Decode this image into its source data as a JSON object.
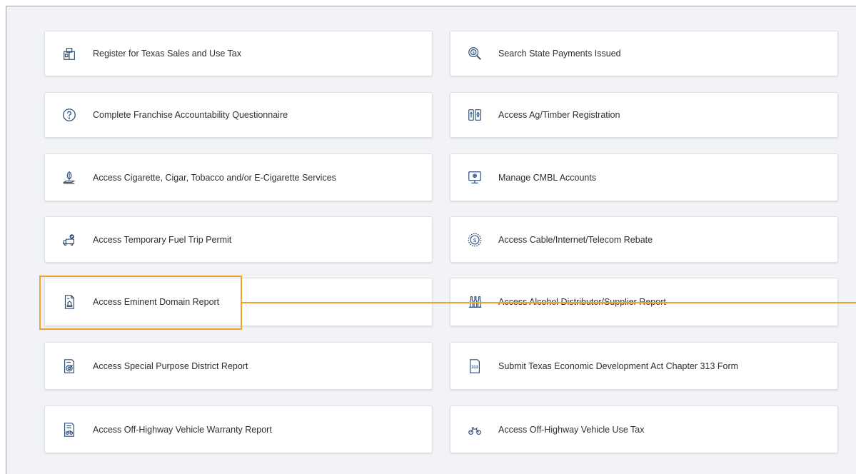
{
  "colors": {
    "accent": "#f0a22b",
    "icon": "#2d4f7c",
    "background": "#f1f3f6"
  },
  "left_cards": [
    {
      "label": "Register for Texas Sales and Use Tax",
      "icon": "register-icon"
    },
    {
      "label": "Complete Franchise Accountability Questionnaire",
      "icon": "question-icon"
    },
    {
      "label": "Access Cigarette, Cigar, Tobacco and/or E-Cigarette Services",
      "icon": "tobacco-leaf-icon"
    },
    {
      "label": "Access Temporary Fuel Trip Permit",
      "icon": "fuel-truck-icon"
    },
    {
      "label": "Access Eminent Domain Report",
      "icon": "domain-report-icon"
    },
    {
      "label": "Access Special Purpose District Report",
      "icon": "target-report-icon"
    },
    {
      "label": "Access Off-Highway Vehicle Warranty Report",
      "icon": "vehicle-report-icon"
    }
  ],
  "right_cards": [
    {
      "label": "Search State Payments Issued",
      "icon": "search-payment-icon"
    },
    {
      "label": "Access Ag/Timber Registration",
      "icon": "ag-timber-icon"
    },
    {
      "label": "Manage CMBL Accounts",
      "icon": "monitor-icon"
    },
    {
      "label": "Access Cable/Internet/Telecom Rebate",
      "icon": "dollar-coin-icon"
    },
    {
      "label": "Access Alcohol Distributor/Supplier Report",
      "icon": "bottles-icon"
    },
    {
      "label": "Submit Texas Economic Development Act Chapter 313 Form",
      "icon": "form-313-icon"
    },
    {
      "label": "Access Off-Highway Vehicle Use Tax",
      "icon": "atv-icon"
    }
  ],
  "form_313_badge": "313"
}
